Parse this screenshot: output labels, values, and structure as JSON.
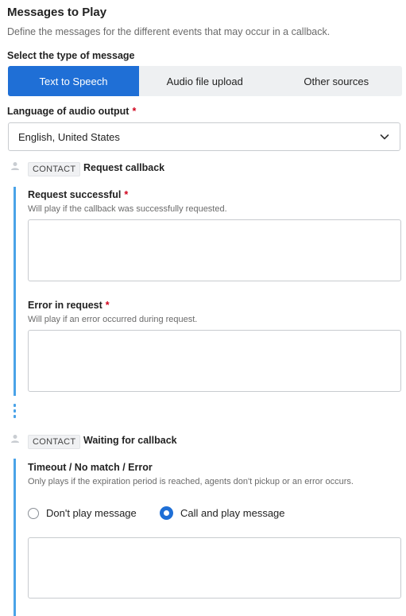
{
  "header": {
    "title": "Messages to Play",
    "description": "Define the messages for the different events that may occur in a callback."
  },
  "message_type": {
    "label": "Select the type of message",
    "options": [
      "Text to Speech",
      "Audio file upload",
      "Other sources"
    ],
    "selected": "Text to Speech"
  },
  "language": {
    "label": "Language of audio output",
    "required_mark": "*",
    "value": "English, United States"
  },
  "steps": [
    {
      "badge": "CONTACT",
      "name": "Request callback",
      "fields": [
        {
          "label": "Request successful",
          "required_mark": "*",
          "hint": "Will play if the callback was successfully requested.",
          "value": ""
        },
        {
          "label": "Error in request",
          "required_mark": "*",
          "hint": "Will play if an error occurred during request.",
          "value": ""
        }
      ]
    },
    {
      "badge": "CONTACT",
      "name": "Waiting for callback",
      "fields": [
        {
          "label": "Timeout / No match / Error",
          "hint": "Only plays if the expiration period is reached, agents don't pickup or an error occurs.",
          "value": ""
        }
      ],
      "radio_options": [
        "Don't play message",
        "Call and play message"
      ],
      "radio_selected": "Call and play message"
    }
  ],
  "colors": {
    "accent": "#1f6fd6",
    "flow_line": "#4aa3e8",
    "required": "#d0021b"
  }
}
